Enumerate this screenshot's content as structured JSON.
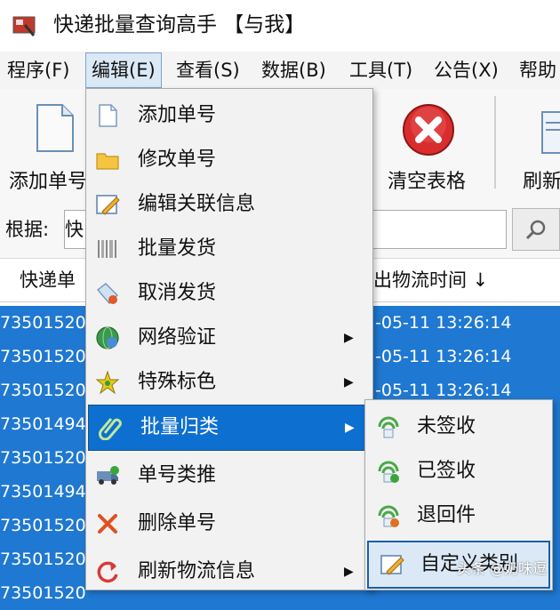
{
  "window": {
    "title": "快递批量查询高手 【与我】"
  },
  "menubar": {
    "items": [
      "程序(F)",
      "编辑(E)",
      "查看(S)",
      "数据(B)",
      "工具(T)",
      "公告(X)",
      "帮助"
    ]
  },
  "toolbar": {
    "add_label": "添加单号",
    "clear_label": "清空表格",
    "refresh_label": "刷新"
  },
  "search": {
    "label": "根据:",
    "value": "快"
  },
  "table": {
    "headers": [
      "快递单",
      "出物流时间 ↓"
    ],
    "rows": [
      {
        "id": "73501520",
        "time": "-05-11 13:26:14"
      },
      {
        "id": "73501520",
        "time": "-05-11 13:26:14"
      },
      {
        "id": "73501520",
        "time": "-05-11 13:26:14"
      },
      {
        "id": "73501494",
        "time": ""
      },
      {
        "id": "73501520",
        "time": ""
      },
      {
        "id": "73501494",
        "time": ""
      },
      {
        "id": "73501520",
        "time": ""
      },
      {
        "id": "73501520",
        "time": ""
      },
      {
        "id": "73501520",
        "time": ""
      }
    ]
  },
  "edit_menu": {
    "items": [
      {
        "label": "添加单号",
        "icon": "document-icon"
      },
      {
        "label": "修改单号",
        "icon": "folder-icon"
      },
      {
        "label": "编辑关联信息",
        "icon": "edit-pen-icon"
      },
      {
        "label": "批量发货",
        "icon": "barcode-icon"
      },
      {
        "label": "取消发货",
        "icon": "tag-cancel-icon"
      },
      {
        "label": "网络验证",
        "icon": "globe-icon"
      },
      {
        "label": "特殊标色",
        "icon": "star-color-icon"
      },
      {
        "label": "批量归类",
        "icon": "paperclip-icon"
      },
      {
        "label": "单号类推",
        "icon": "truck-icon"
      },
      {
        "label": "删除单号",
        "icon": "delete-x-icon"
      },
      {
        "label": "刷新物流信息",
        "icon": "refresh-icon"
      }
    ]
  },
  "classify_submenu": {
    "items": [
      {
        "label": "未签收",
        "icon": "signal-pending-icon"
      },
      {
        "label": "已签收",
        "icon": "signal-signed-icon"
      },
      {
        "label": "退回件",
        "icon": "signal-returned-icon"
      },
      {
        "label": "自定义类别",
        "icon": "custom-edit-icon"
      }
    ]
  },
  "watermark": "头条 @奶味逗",
  "colors": {
    "selection": "#1f78d1",
    "menu_highlight": "#0d6fd0",
    "clear_button": "#d92d2d"
  }
}
